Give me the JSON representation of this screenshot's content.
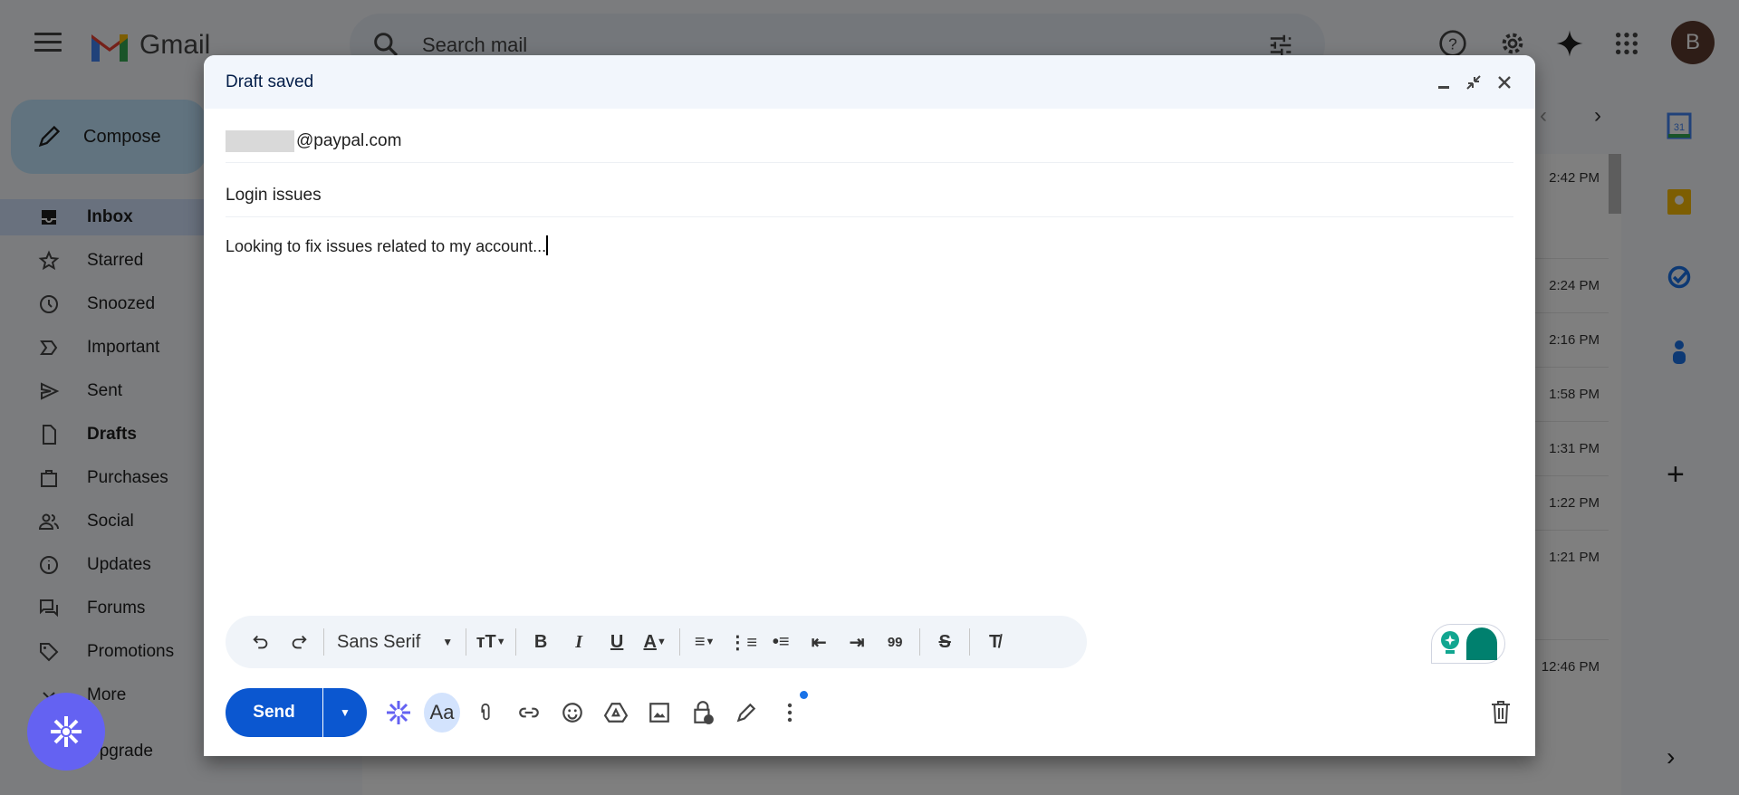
{
  "app": {
    "name": "Gmail",
    "search_placeholder": "Search mail",
    "avatar_letter": "B"
  },
  "sidebar": {
    "compose_label": "Compose",
    "items": [
      {
        "label": "Inbox",
        "icon": "inbox-icon"
      },
      {
        "label": "Starred",
        "icon": "star-icon"
      },
      {
        "label": "Snoozed",
        "icon": "clock-icon"
      },
      {
        "label": "Important",
        "icon": "important-icon"
      },
      {
        "label": "Sent",
        "icon": "send-icon"
      },
      {
        "label": "Drafts",
        "icon": "draft-icon"
      },
      {
        "label": "Purchases",
        "icon": "bag-icon"
      },
      {
        "label": "Social",
        "icon": "people-icon"
      },
      {
        "label": "Updates",
        "icon": "info-icon"
      },
      {
        "label": "Forums",
        "icon": "forum-icon"
      },
      {
        "label": "Promotions",
        "icon": "tag-icon"
      },
      {
        "label": "More",
        "icon": "chevron-down-icon"
      }
    ],
    "upgrade_label": "Upgrade"
  },
  "list": {
    "times": [
      "2:42 PM",
      "2:24 PM",
      "2:16 PM",
      "1:58 PM",
      "1:31 PM",
      "1:22 PM",
      "1:21 PM",
      "12:46 PM"
    ]
  },
  "compose": {
    "title": "Draft saved",
    "to_suffix": "@paypal.com",
    "subject": "Login issues",
    "body": "Looking to fix issues related to my account...",
    "font": "Sans Serif",
    "send_label": "Send",
    "quote_label": "99",
    "aa_label": "Aa"
  },
  "colors": {
    "accent": "#0b57d0",
    "fab": "#6462f2",
    "grammar": "#00806e"
  }
}
